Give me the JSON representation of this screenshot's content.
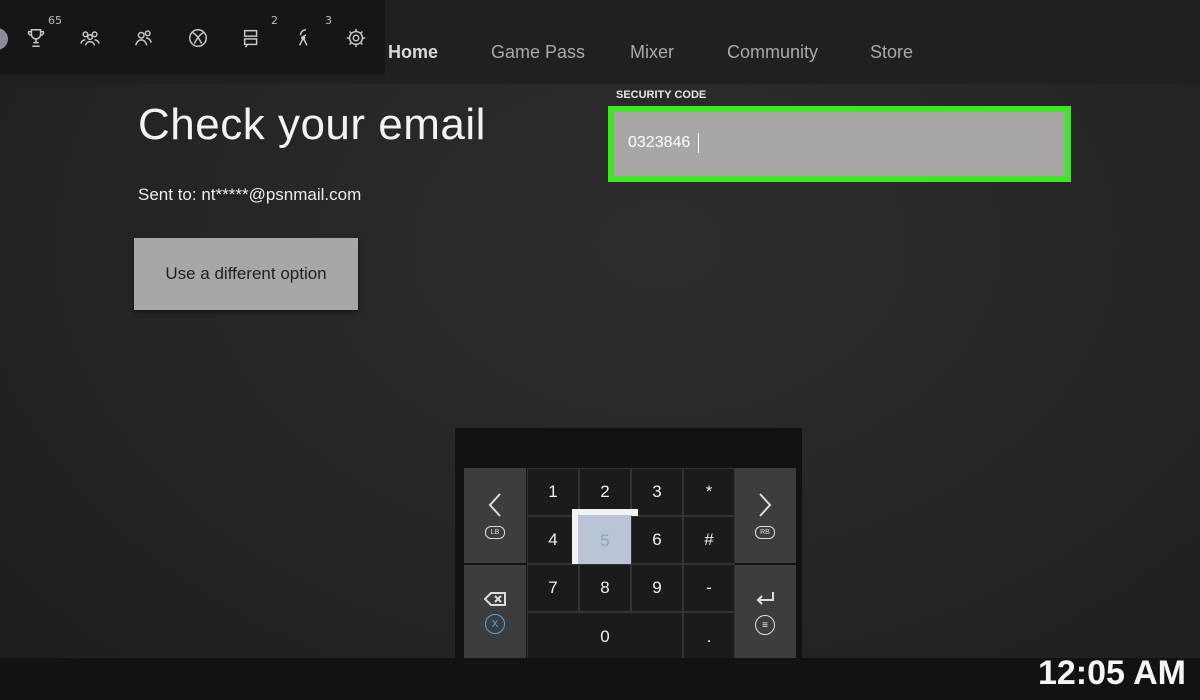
{
  "topbar": {
    "icons": [
      {
        "name": "achievements-icon",
        "badge": "65"
      },
      {
        "name": "friends-icon",
        "badge": ""
      },
      {
        "name": "party-icon",
        "badge": ""
      },
      {
        "name": "xbox-icon",
        "badge": ""
      },
      {
        "name": "messages-icon",
        "badge": "2"
      },
      {
        "name": "broadcast-icon",
        "badge": "3"
      },
      {
        "name": "settings-icon",
        "badge": ""
      }
    ],
    "nav": [
      "Home",
      "Game Pass",
      "Mixer",
      "Community",
      "Store"
    ]
  },
  "main": {
    "title": "Check your email",
    "sent_to": "Sent to: nt*****@psnmail.com",
    "alt_button": "Use a different option"
  },
  "security": {
    "label": "SECURITY CODE",
    "value": "0323846"
  },
  "keypad": {
    "keys": [
      "1",
      "2",
      "3",
      "*",
      "4",
      "5",
      "6",
      "#",
      "7",
      "8",
      "9",
      "-",
      "0",
      "."
    ],
    "selected": "5",
    "lb": "LB",
    "rb": "RB",
    "x": "X"
  },
  "clock": "12:05 AM",
  "colors": {
    "accent": "#3fe628",
    "selected_key": "#b9c4d6"
  }
}
